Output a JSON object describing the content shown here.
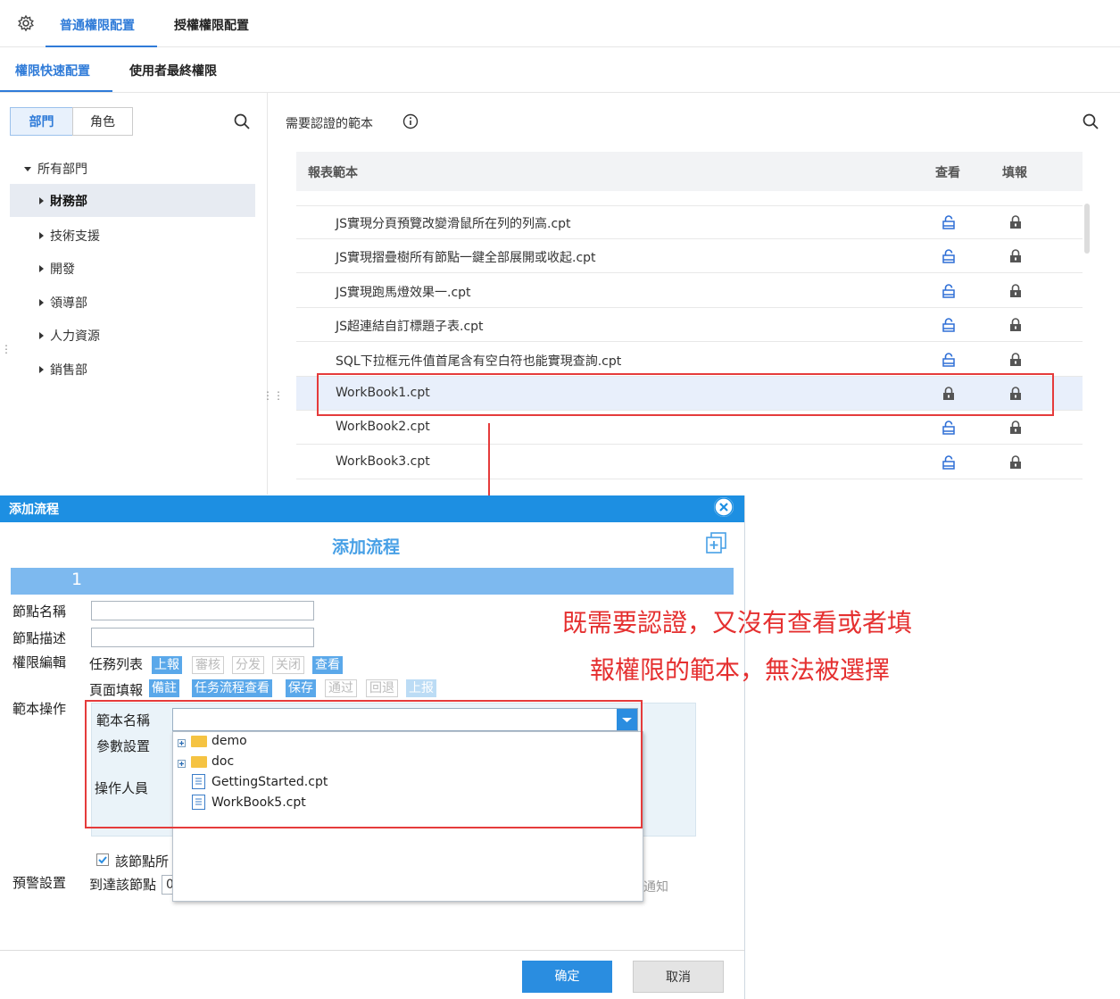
{
  "top_tabs": [
    {
      "label": "普通權限配置",
      "active": true
    },
    {
      "label": "授權權限配置",
      "active": false
    }
  ],
  "sub_tabs": [
    {
      "label": "權限快速配置",
      "active": true
    },
    {
      "label": "使用者最終權限",
      "active": false
    }
  ],
  "left_panel": {
    "segments": [
      "部門",
      "角色"
    ],
    "tree_root": "所有部門",
    "departments": [
      "財務部",
      "技術支援",
      "開發",
      "領導部",
      "人力資源",
      "銷售部"
    ],
    "selected": "財務部"
  },
  "right_panel": {
    "title": "需要認證的範本",
    "columns": {
      "template": "報表範本",
      "view": "查看",
      "fill": "填報"
    },
    "rows": [
      {
        "name": "JS實現分頁預覽改變滑鼠所在列的列高.cpt",
        "view": "unlocked",
        "fill": "locked"
      },
      {
        "name": "JS實現摺疊樹所有節點一鍵全部展開或收起.cpt",
        "view": "unlocked",
        "fill": "locked"
      },
      {
        "name": "JS實現跑馬燈效果一.cpt",
        "view": "unlocked",
        "fill": "locked"
      },
      {
        "name": "JS超連結自訂標題子表.cpt",
        "view": "unlocked",
        "fill": "locked"
      },
      {
        "name": "SQL下拉框元件值首尾含有空白符也能實現查詢.cpt",
        "view": "unlocked",
        "fill": "locked"
      },
      {
        "name": "WorkBook1.cpt",
        "view": "locked",
        "fill": "locked"
      },
      {
        "name": "WorkBook2.cpt",
        "view": "unlocked",
        "fill": "locked"
      },
      {
        "name": "WorkBook3.cpt",
        "view": "unlocked",
        "fill": "locked"
      }
    ]
  },
  "dialog": {
    "window_title": "添加流程",
    "heading": "添加流程",
    "step": "1",
    "labels": {
      "node_name": "節點名稱",
      "node_desc": "節點描述",
      "perm_edit": "權限編輯",
      "task_list": "任務列表",
      "page_fill": "頁面填報",
      "template_op": "範本操作",
      "template_name": "範本名稱",
      "param_setting": "參數設置",
      "operator": "操作人員",
      "node_checkbox": "該節點所",
      "warning": "預警設置",
      "arrive_node": "到達該節點",
      "notify_tail": "通知",
      "arrive_value": "0"
    },
    "task_buttons": [
      {
        "label": "上報",
        "state": "on"
      },
      {
        "label": "審核",
        "state": "off"
      },
      {
        "label": "分发",
        "state": "off"
      },
      {
        "label": "关闭",
        "state": "off"
      },
      {
        "label": "查看",
        "state": "on"
      }
    ],
    "page_buttons": [
      {
        "label": "備註",
        "state": "on"
      },
      {
        "label": "任务流程查看",
        "state": "on"
      },
      {
        "label": "保存",
        "state": "on"
      },
      {
        "label": "通过",
        "state": "off"
      },
      {
        "label": "回退",
        "state": "off"
      },
      {
        "label": "上报",
        "state": "faded"
      }
    ],
    "dropdown_items": [
      {
        "label": "demo",
        "type": "folder"
      },
      {
        "label": "doc",
        "type": "folder"
      },
      {
        "label": "GettingStarted.cpt",
        "type": "file"
      },
      {
        "label": "WorkBook5.cpt",
        "type": "file"
      }
    ],
    "ok": "确定",
    "cancel": "取消"
  },
  "annotation": {
    "line1": "既需要認證，又沒有查看或者填",
    "line2": "報權限的範本，無法被選擇",
    "color": "#e53030"
  },
  "colors": {
    "accent": "#2f7bd8",
    "dialog_header": "#1d8fe2",
    "highlight": "#e53b3b"
  }
}
